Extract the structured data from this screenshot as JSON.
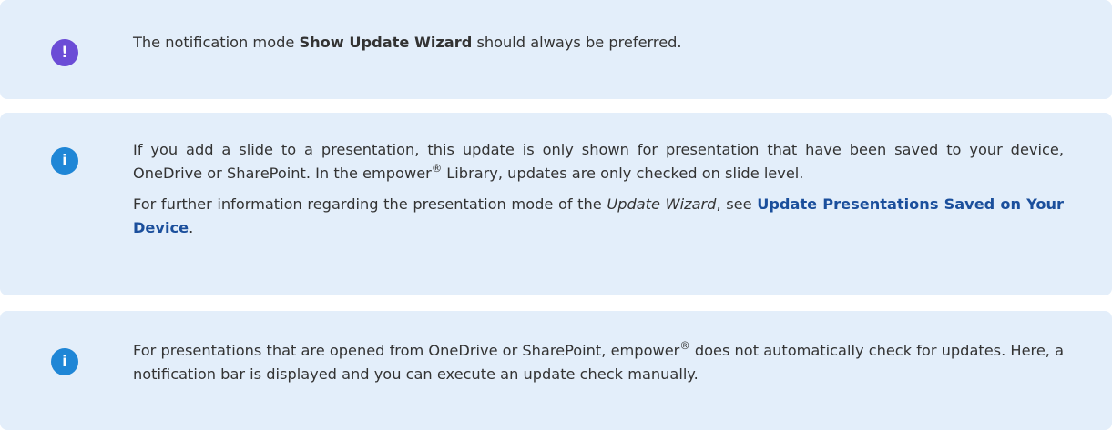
{
  "callouts": [
    {
      "type": "warning",
      "icon": "exclamation-icon",
      "paragraphs": [
        {
          "before": "The notification mode ",
          "bold": "Show Update Wizard",
          "after": " should always be preferred."
        }
      ]
    },
    {
      "type": "info",
      "icon": "info-icon",
      "paragraphs": [
        {
          "before": "If you add a slide to a presentation, this update is only shown for presentation that have been saved to your device, OneDrive or SharePoint. In the empower",
          "sup": "®",
          "after": " Library, updates are only checked on slide level."
        },
        {
          "before": "For further information regarding the presentation mode of the ",
          "italic": "Update Wizard",
          "middle": ", see ",
          "link": "Update Presentations Saved on Your Device",
          "after": "."
        }
      ]
    },
    {
      "type": "info",
      "icon": "info-icon",
      "paragraphs": [
        {
          "before": "For presentations that are opened from OneDrive or SharePoint, empower",
          "sup": "®",
          "after": " does not automatically check for updates. Here, a notification bar is displayed and you can execute an update check manually."
        }
      ]
    }
  ],
  "icons": {
    "warning_glyph": "!",
    "info_glyph": "i"
  },
  "colors": {
    "callout_background": "#e3eefa",
    "warning_badge": "#6b4cd6",
    "info_badge": "#1f86d6",
    "link": "#1b4f9c",
    "text": "#333333"
  }
}
